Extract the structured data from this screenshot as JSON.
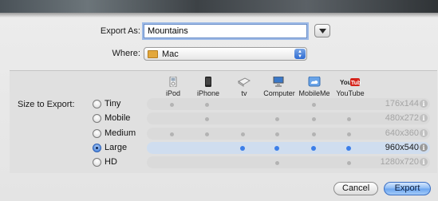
{
  "export_as": {
    "label": "Export As:",
    "value": "Mountains"
  },
  "where": {
    "label": "Where:",
    "value": "Mac"
  },
  "size_label": "Size to Export:",
  "devices": [
    {
      "name": "iPod",
      "icon": "ipod-icon"
    },
    {
      "name": "iPhone",
      "icon": "iphone-icon"
    },
    {
      "name": "tv",
      "icon": "apple-tv-icon"
    },
    {
      "name": "Computer",
      "icon": "computer-icon"
    },
    {
      "name": "MobileMe",
      "icon": "mobileme-icon"
    },
    {
      "name": "YouTube",
      "icon": "youtube-icon"
    }
  ],
  "sizes": [
    {
      "label": "Tiny",
      "resolution": "176x144",
      "selected": false,
      "compat": [
        true,
        true,
        false,
        false,
        true,
        false
      ]
    },
    {
      "label": "Mobile",
      "resolution": "480x272",
      "selected": false,
      "compat": [
        false,
        true,
        false,
        true,
        true,
        true
      ]
    },
    {
      "label": "Medium",
      "resolution": "640x360",
      "selected": false,
      "compat": [
        true,
        true,
        true,
        true,
        true,
        true
      ]
    },
    {
      "label": "Large",
      "resolution": "960x540",
      "selected": true,
      "compat": [
        false,
        false,
        true,
        true,
        true,
        true
      ]
    },
    {
      "label": "HD",
      "resolution": "1280x720",
      "selected": false,
      "compat": [
        false,
        false,
        false,
        true,
        false,
        true
      ]
    }
  ],
  "buttons": {
    "cancel": "Cancel",
    "export": "Export"
  },
  "colors": {
    "accent": "#3c7ee8",
    "selected_row": "#cfddef"
  }
}
